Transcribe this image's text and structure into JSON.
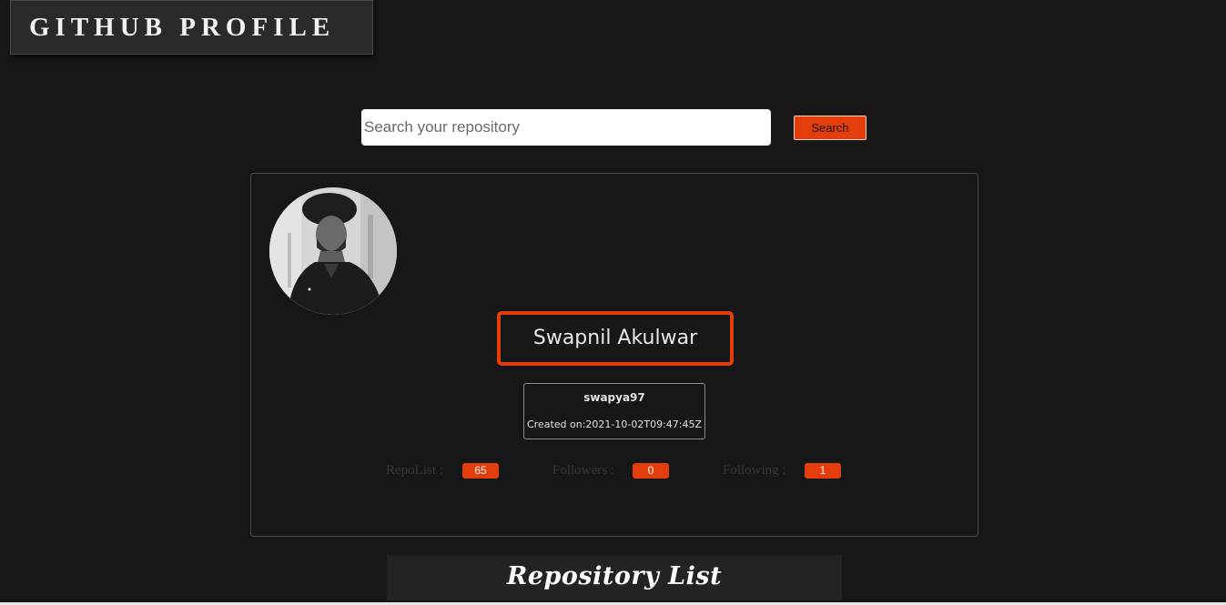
{
  "header": {
    "title": "GITHUB PROFILE"
  },
  "search": {
    "placeholder": "Search your repository",
    "value": "",
    "button_label": "Search"
  },
  "profile": {
    "name": "Swapnil Akulwar",
    "login": "swapya97",
    "created": "Created on:2021-10-02T09:47:45Z",
    "stats": {
      "repos_label": "RepoList :",
      "repos_value": "65",
      "followers_label": "Followers :",
      "followers_value": "0",
      "following_label": "Following :",
      "following_value": "1"
    }
  },
  "repositories": {
    "heading": "Repository List"
  },
  "colors": {
    "background": "#181717",
    "accent": "#e33d0b",
    "card_border": "#4b4b4b"
  }
}
